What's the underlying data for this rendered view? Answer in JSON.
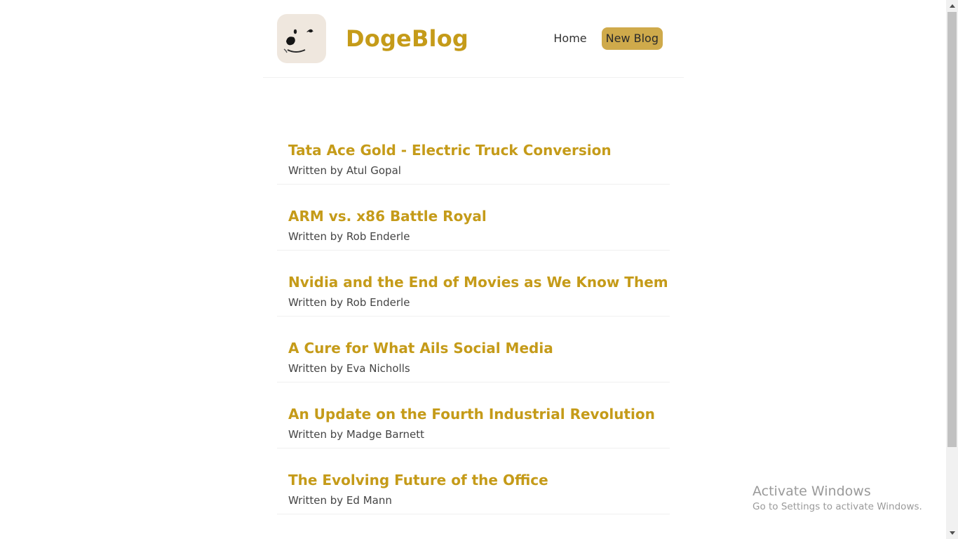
{
  "navbar": {
    "brand": "DogeBlog",
    "logo_icon": "doge-face-icon",
    "links": [
      {
        "label": "Home"
      },
      {
        "label": "New Blog"
      }
    ]
  },
  "blogs": [
    {
      "title": "Tata Ace Gold - Electric Truck Conversion",
      "author_line": "Written by Atul Gopal"
    },
    {
      "title": "ARM vs. x86 Battle Royal",
      "author_line": "Written by Rob Enderle"
    },
    {
      "title": "Nvidia and the End of Movies as We Know Them",
      "author_line": "Written by Rob Enderle"
    },
    {
      "title": "A Cure for What Ails Social Media",
      "author_line": "Written by Eva Nicholls"
    },
    {
      "title": "An Update on the Fourth Industrial Revolution",
      "author_line": "Written by Madge Barnett"
    },
    {
      "title": "The Evolving Future of the Office",
      "author_line": "Written by Ed Mann"
    }
  ],
  "watermark": {
    "title": "Activate Windows",
    "subtitle": "Go to Settings to activate Windows."
  },
  "colors": {
    "accent": "#c59b19",
    "button_bg": "#cfaa4b",
    "logo_bg": "#efe7de",
    "divider": "#f0f0f0"
  }
}
